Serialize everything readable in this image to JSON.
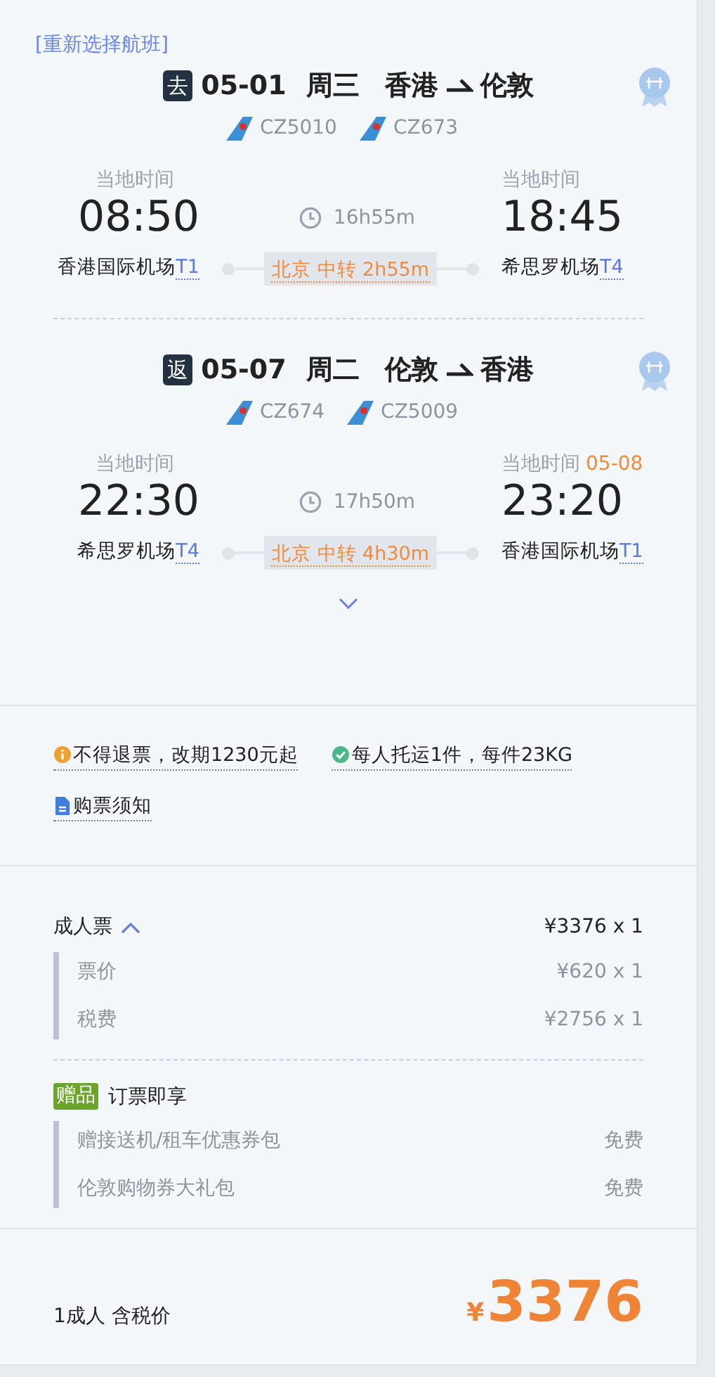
{
  "back_link": "[重新选择航班]",
  "segments": [
    {
      "badge": "去",
      "date": "05-01",
      "weekday": "周三",
      "from": "香港",
      "to": "伦敦",
      "flights": [
        "CZ5010",
        "CZ673"
      ],
      "departure": {
        "label": "当地时间",
        "time": "08:50",
        "airport": "香港国际机场",
        "terminal": "T1"
      },
      "duration": "16h55m",
      "transfer": "北京 中转 2h55m",
      "arrival": {
        "label": "当地时间",
        "time": "18:45",
        "airport": "希思罗机场",
        "terminal": "T4"
      }
    },
    {
      "badge": "返",
      "date": "05-07",
      "weekday": "周二",
      "from": "伦敦",
      "to": "香港",
      "flights": [
        "CZ674",
        "CZ5009"
      ],
      "departure": {
        "label": "当地时间",
        "time": "22:30",
        "airport": "希思罗机场",
        "terminal": "T4"
      },
      "duration": "17h50m",
      "transfer": "北京 中转 4h30m",
      "arrival": {
        "label": "当地时间",
        "date": "05-08",
        "time": "23:20",
        "airport": "香港国际机场",
        "terminal": "T1"
      }
    }
  ],
  "details_expanded": false,
  "notice_rows": [
    [
      {
        "kind": "info",
        "text": "不得退票，改期1230元起"
      },
      {
        "kind": "check",
        "text": "每人托运1件，每件23KG"
      }
    ],
    [
      {
        "kind": "doc",
        "text": "购票须知"
      }
    ]
  ],
  "fare": {
    "label": "成人票",
    "expanded": true,
    "amount": "¥3376 x 1",
    "items": [
      {
        "label": "票价",
        "amount": "¥620 x 1"
      },
      {
        "label": "税费",
        "amount": "¥2756 x 1"
      }
    ]
  },
  "gift": {
    "badge": "赠品",
    "title": "订票即享",
    "items": [
      {
        "label": "赠接送机/租车优惠券包",
        "amount": "免费"
      },
      {
        "label": "伦敦购物券大礼包",
        "amount": "免费"
      }
    ]
  },
  "total": {
    "label": "1成人 含税价",
    "currency": "¥",
    "amount": "3376"
  }
}
